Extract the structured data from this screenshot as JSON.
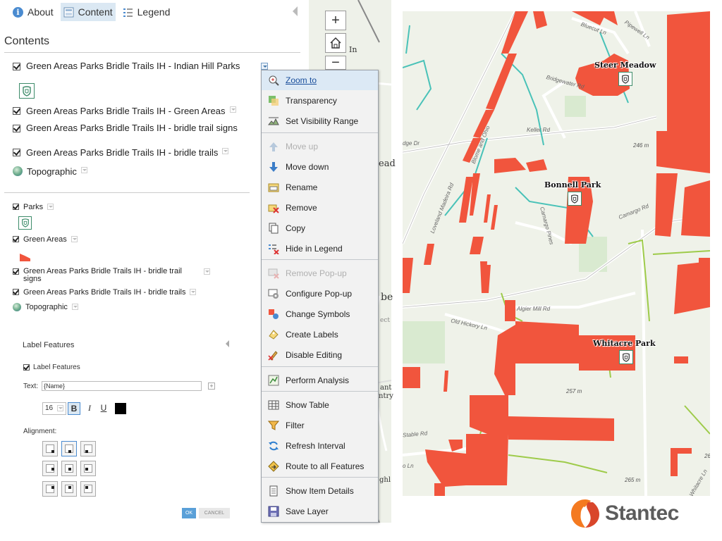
{
  "tabs": [
    {
      "label": "About",
      "icon": "info-icon"
    },
    {
      "label": "Content",
      "icon": "content-icon",
      "active": true
    },
    {
      "label": "Legend",
      "icon": "legend-icon"
    }
  ],
  "contents_title": "Contents",
  "layers": [
    {
      "name": "Green Areas Parks Bridle Trails IH - Indian Hill Parks"
    },
    {
      "name": "Green Areas Parks Bridle Trails IH - Green Areas"
    },
    {
      "name": "Green Areas Parks Bridle Trails IH - bridle trail signs"
    },
    {
      "name": "Green Areas Parks Bridle Trails IH - bridle trails"
    },
    {
      "name": "Topographic"
    }
  ],
  "sublayers": [
    {
      "name": "Parks"
    },
    {
      "name": "Green Areas"
    },
    {
      "name": "Green Areas Parks Bridle Trails IH - bridle trail signs"
    },
    {
      "name": "Green Areas Parks Bridle Trails IH - bridle trails"
    },
    {
      "name": "Topographic"
    }
  ],
  "label_features": {
    "title": "Label Features",
    "checkbox_label": "Label Features",
    "text_label": "Text:",
    "text_value": "{Name}",
    "font_size": "16",
    "bold": "B",
    "italic": "I",
    "underline": "U",
    "color": "#000000",
    "alignment_label": "Alignment:",
    "ok": "OK",
    "cancel": "CANCEL"
  },
  "map_strip": {
    "zoom_in": "+",
    "zoom_out": "−",
    "fragments": [
      "In",
      "ead",
      "be",
      "ect",
      "ant",
      "ntry",
      "ghl"
    ]
  },
  "context_menu": [
    {
      "label": "Zoom to",
      "icon": "zoom-icon",
      "state": "highlighted"
    },
    {
      "label": "Transparency",
      "icon": "transparency-icon"
    },
    {
      "label": "Set Visibility Range",
      "icon": "visibility-range-icon"
    },
    {
      "label": "Move up",
      "icon": "arrow-up-icon",
      "state": "disabled"
    },
    {
      "label": "Move down",
      "icon": "arrow-down-icon"
    },
    {
      "label": "Rename",
      "icon": "rename-icon"
    },
    {
      "label": "Remove",
      "icon": "remove-icon"
    },
    {
      "label": "Copy",
      "icon": "copy-icon"
    },
    {
      "label": "Hide in Legend",
      "icon": "hide-legend-icon"
    },
    {
      "label": "Remove Pop-up",
      "icon": "remove-popup-icon",
      "state": "disabled"
    },
    {
      "label": "Configure Pop-up",
      "icon": "configure-popup-icon"
    },
    {
      "label": "Change Symbols",
      "icon": "symbols-icon"
    },
    {
      "label": "Create Labels",
      "icon": "labels-icon"
    },
    {
      "label": "Disable Editing",
      "icon": "editing-icon"
    },
    {
      "label": "Perform Analysis",
      "icon": "analysis-icon"
    },
    {
      "label": "Show Table",
      "icon": "table-icon"
    },
    {
      "label": "Filter",
      "icon": "filter-icon"
    },
    {
      "label": "Refresh Interval",
      "icon": "refresh-icon"
    },
    {
      "label": "Route to all Features",
      "icon": "route-icon"
    },
    {
      "label": "Show Item Details",
      "icon": "details-icon"
    },
    {
      "label": "Save Layer",
      "icon": "save-icon"
    }
  ],
  "map": {
    "parks": [
      "Steer Meadow",
      "Bonnell Park",
      "Whitacre Park"
    ],
    "roads": [
      "Bluecut Ln",
      "Pipewell Ln",
      "Bridgewater Rd",
      "Keller Rd",
      "Camargo Pines",
      "Camargo Rd",
      "Loveland Madeira Rd",
      "Blome and Ohio",
      "Old Hickory Ln",
      "Algier Mill Rd",
      "dge Dr",
      "Stable Rd",
      "o Ln",
      "Whitacre Ln"
    ],
    "elevations": [
      "246 m",
      "257 m",
      "265 m",
      "26"
    ],
    "park_color": "#f1553d",
    "trail_color": "#9ecb4a",
    "stream_color": "#49c2b8"
  },
  "logo": {
    "text": "Stantec",
    "color": "#f47a20"
  }
}
